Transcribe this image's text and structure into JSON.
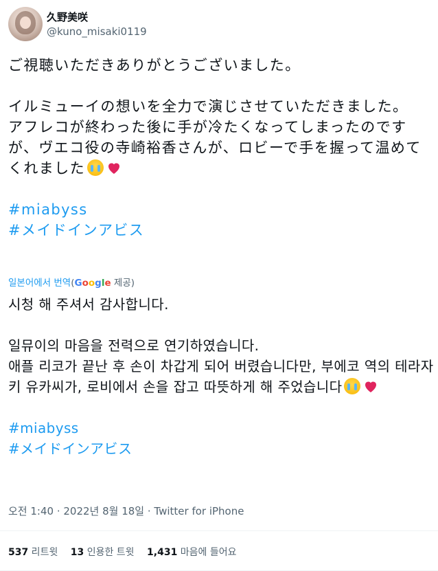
{
  "author": {
    "name": "久野美咲",
    "handle": "@kuno_misaki0119"
  },
  "tweet": {
    "line1": "ご視聴いただきありがとうございました。",
    "line2": "イルミューイの想いを全力で演じさせていただきました。",
    "line3": "アフレコが終わった後に手が冷たくなってしまったのですが、ヴエコ役の寺崎裕香さんが、ロビーで手を握って温めてくれました",
    "hashtag1": "#miabyss",
    "hashtag2": "#メイドインアビス"
  },
  "translation": {
    "label": "일본어에서 번역",
    "provider_open": "(",
    "provider_G": "G",
    "provider_o1": "o",
    "provider_o2": "o",
    "provider_g": "g",
    "provider_l": "l",
    "provider_e": "e",
    "provider_suffix": " 제공)",
    "line1": "시청 해 주셔서 감사합니다.",
    "line2": "일뮤이의 마음을 전력으로 연기하였습니다.",
    "line3": "애플 리코가 끝난 후 손이 차갑게 되어 버렸습니다만, 부에코 역의 테라자키 유카씨가, 로비에서 손을 잡고 따뜻하게 해 주었습니다",
    "hashtag1": "#miabyss",
    "hashtag2": "#メイドインアビス"
  },
  "meta": {
    "timestamp": "오전 1:40 · 2022년 8월 18일 · Twitter for iPhone"
  },
  "stats": {
    "retweets_count": "537",
    "retweets_label": " 리트윗",
    "quotes_count": "13",
    "quotes_label": " 인용한 트윗",
    "likes_count": "1,431",
    "likes_label": " 마음에 들어요"
  },
  "icons": [
    "crying-face-icon",
    "heart-icon"
  ],
  "colors": {
    "link": "#1d9bf0",
    "text": "#0f1419",
    "muted": "#536471"
  }
}
